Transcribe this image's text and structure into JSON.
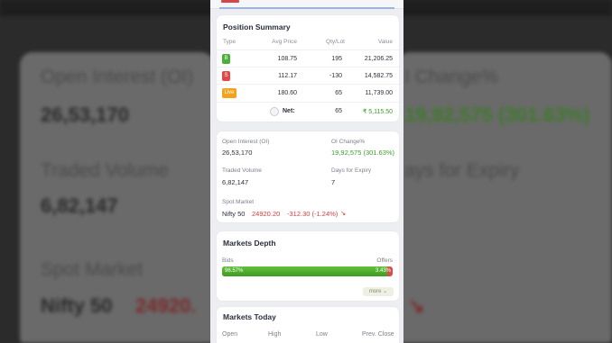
{
  "background": {
    "open_interest_label": "Open Interest (OI)",
    "open_interest_value": "26,53,170",
    "traded_volume_label": "Traded Volume",
    "traded_volume_value": "6,82,147",
    "spot_market_label": "Spot Market",
    "spot_value": "Nifty 50",
    "spot_price": "24920.",
    "oi_change_label": "I Change%",
    "oi_change_value": "19,92,575 (301.63%)",
    "days_expiry_label": "ays for Expiry"
  },
  "position_summary": {
    "title": "Position Summary",
    "headers": [
      "Type",
      "Avg Price",
      "Qty/Lot",
      "Value"
    ],
    "rows": [
      {
        "type": "B",
        "avg_price": "108.75",
        "qty": "195",
        "value": "21,206.25"
      },
      {
        "type": "S",
        "avg_price": "112.17",
        "qty": "-130",
        "value": "14,582.75"
      },
      {
        "type": "Live",
        "avg_price": "180.60",
        "qty": "65",
        "value": "11,739.00"
      }
    ],
    "net_label": "Net:",
    "net_qty": "65",
    "net_value": "₹ 5,115.50"
  },
  "oi_card": {
    "open_interest_label": "Open Interest (OI)",
    "open_interest_value": "26,53,170",
    "oi_change_label": "OI Change%",
    "oi_change_value": "19,92,575 (301.63%)",
    "traded_volume_label": "Traded Volume",
    "traded_volume_value": "6,82,147",
    "days_expiry_label": "Days for Expiry",
    "days_expiry_value": "7",
    "spot_market_label": "Spot Market",
    "spot_index": "Nifty 50",
    "spot_price": "24920.20",
    "spot_change": "-312.30 (-1.24%)",
    "spot_trend_icon": "↘"
  },
  "market_depth": {
    "title": "Markets Depth",
    "bids_label": "Bids",
    "offers_label": "Offers",
    "bids_pct_text": "96.57%",
    "offers_pct_text": "3.43%",
    "bids_fraction": 0.9657,
    "more_label": "more ⌄"
  },
  "markets_today": {
    "title": "Markets Today",
    "headers": [
      "Open",
      "High",
      "Low",
      "Prev. Close"
    ]
  },
  "colors": {
    "buy": "#4caf3a",
    "sell": "#e04848",
    "live": "#f2a31e",
    "positive": "#3e9b2e",
    "negative": "#d33c3c"
  }
}
